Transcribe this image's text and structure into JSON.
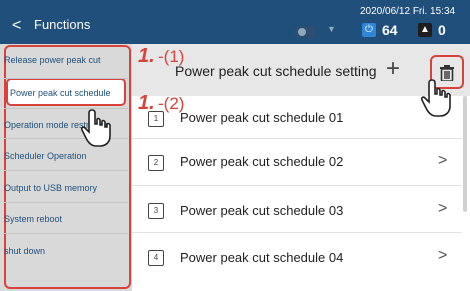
{
  "topbar": {
    "back_label": "<",
    "title": "Functions",
    "datetime": "2020/06/12 Fri. 15:34",
    "power_count": "64",
    "warning_count": "0"
  },
  "sidebar": {
    "items": [
      {
        "label": "Release power peak cut"
      },
      {
        "label": "Power peak cut schedule"
      },
      {
        "label": "Operation mode restriction"
      },
      {
        "label": "Scheduler Operation"
      },
      {
        "label": "Output to USB memory"
      },
      {
        "label": "System reboot"
      },
      {
        "label": "shut down"
      }
    ]
  },
  "main": {
    "header_title": "Power peak cut schedule setting",
    "add_label": "+",
    "schedules": [
      {
        "label": "Power peak cut schedule 01",
        "icon_num": "1"
      },
      {
        "label": "Power peak cut schedule 02",
        "icon_num": "2"
      },
      {
        "label": "Power peak cut schedule 03",
        "icon_num": "3"
      },
      {
        "label": "Power peak cut schedule 04",
        "icon_num": "4"
      }
    ],
    "chevron": ">"
  },
  "callouts": {
    "c1_num": "1.",
    "c1_sub": "-(1)",
    "c2_num": "1.",
    "c2_sub": "-(2)"
  },
  "colors": {
    "header_bg": "#1f4f7a",
    "highlight": "#d9423a",
    "power_icon": "#2f86d6"
  }
}
